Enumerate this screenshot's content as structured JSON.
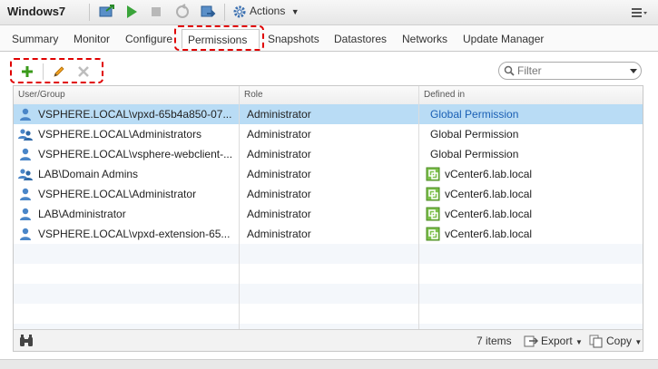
{
  "header": {
    "title": "Windows7",
    "actions_label": "Actions",
    "icons": [
      "vm-console-icon",
      "power-on-icon",
      "power-off-icon",
      "suspend-icon",
      "migrate-icon",
      "actions-gear-icon",
      "menu-icon"
    ]
  },
  "tabs": [
    {
      "label": "Summary"
    },
    {
      "label": "Monitor"
    },
    {
      "label": "Configure"
    },
    {
      "label": "Permissions",
      "active": true
    },
    {
      "label": "Snapshots"
    },
    {
      "label": "Datastores"
    },
    {
      "label": "Networks"
    },
    {
      "label": "Update Manager"
    }
  ],
  "toolbar": {
    "add_icon": "plus-icon",
    "edit_icon": "pencil-icon",
    "delete_icon": "x-icon"
  },
  "filter": {
    "placeholder": "Filter"
  },
  "grid": {
    "columns": [
      "User/Group",
      "Role",
      "Defined in"
    ],
    "rows": [
      {
        "user": "VSPHERE.LOCAL\\vpxd-65b4a850-07...",
        "user_icon": "user-icon",
        "role": "Administrator",
        "defined_in": "Global Permission",
        "defined_icon": null,
        "selected": true
      },
      {
        "user": "VSPHERE.LOCAL\\Administrators",
        "user_icon": "group-icon",
        "role": "Administrator",
        "defined_in": "Global Permission",
        "defined_icon": null,
        "selected": false
      },
      {
        "user": "VSPHERE.LOCAL\\vsphere-webclient-...",
        "user_icon": "user-icon",
        "role": "Administrator",
        "defined_in": "Global Permission",
        "defined_icon": null,
        "selected": false
      },
      {
        "user": "LAB\\Domain Admins",
        "user_icon": "group-icon",
        "role": "Administrator",
        "defined_in": "vCenter6.lab.local",
        "defined_icon": "vcenter-icon",
        "selected": false
      },
      {
        "user": "VSPHERE.LOCAL\\Administrator",
        "user_icon": "user-icon",
        "role": "Administrator",
        "defined_in": "vCenter6.lab.local",
        "defined_icon": "vcenter-icon",
        "selected": false
      },
      {
        "user": "LAB\\Administrator",
        "user_icon": "user-icon",
        "role": "Administrator",
        "defined_in": "vCenter6.lab.local",
        "defined_icon": "vcenter-icon",
        "selected": false
      },
      {
        "user": "VSPHERE.LOCAL\\vpxd-extension-65...",
        "user_icon": "user-icon",
        "role": "Administrator",
        "defined_in": "vCenter6.lab.local",
        "defined_icon": "vcenter-icon",
        "selected": false
      }
    ],
    "empty_rows": 5,
    "footer": {
      "count": "7 items",
      "export_label": "Export",
      "copy_label": "Copy",
      "binoculars_icon": "binoculars-icon"
    }
  },
  "colors": {
    "selected_row": "#b9dcf5",
    "link_blue": "#1a5fb4",
    "highlight_red": "#e00000",
    "add_green": "#3a9a1a",
    "stripe": "#f4f7fb"
  }
}
